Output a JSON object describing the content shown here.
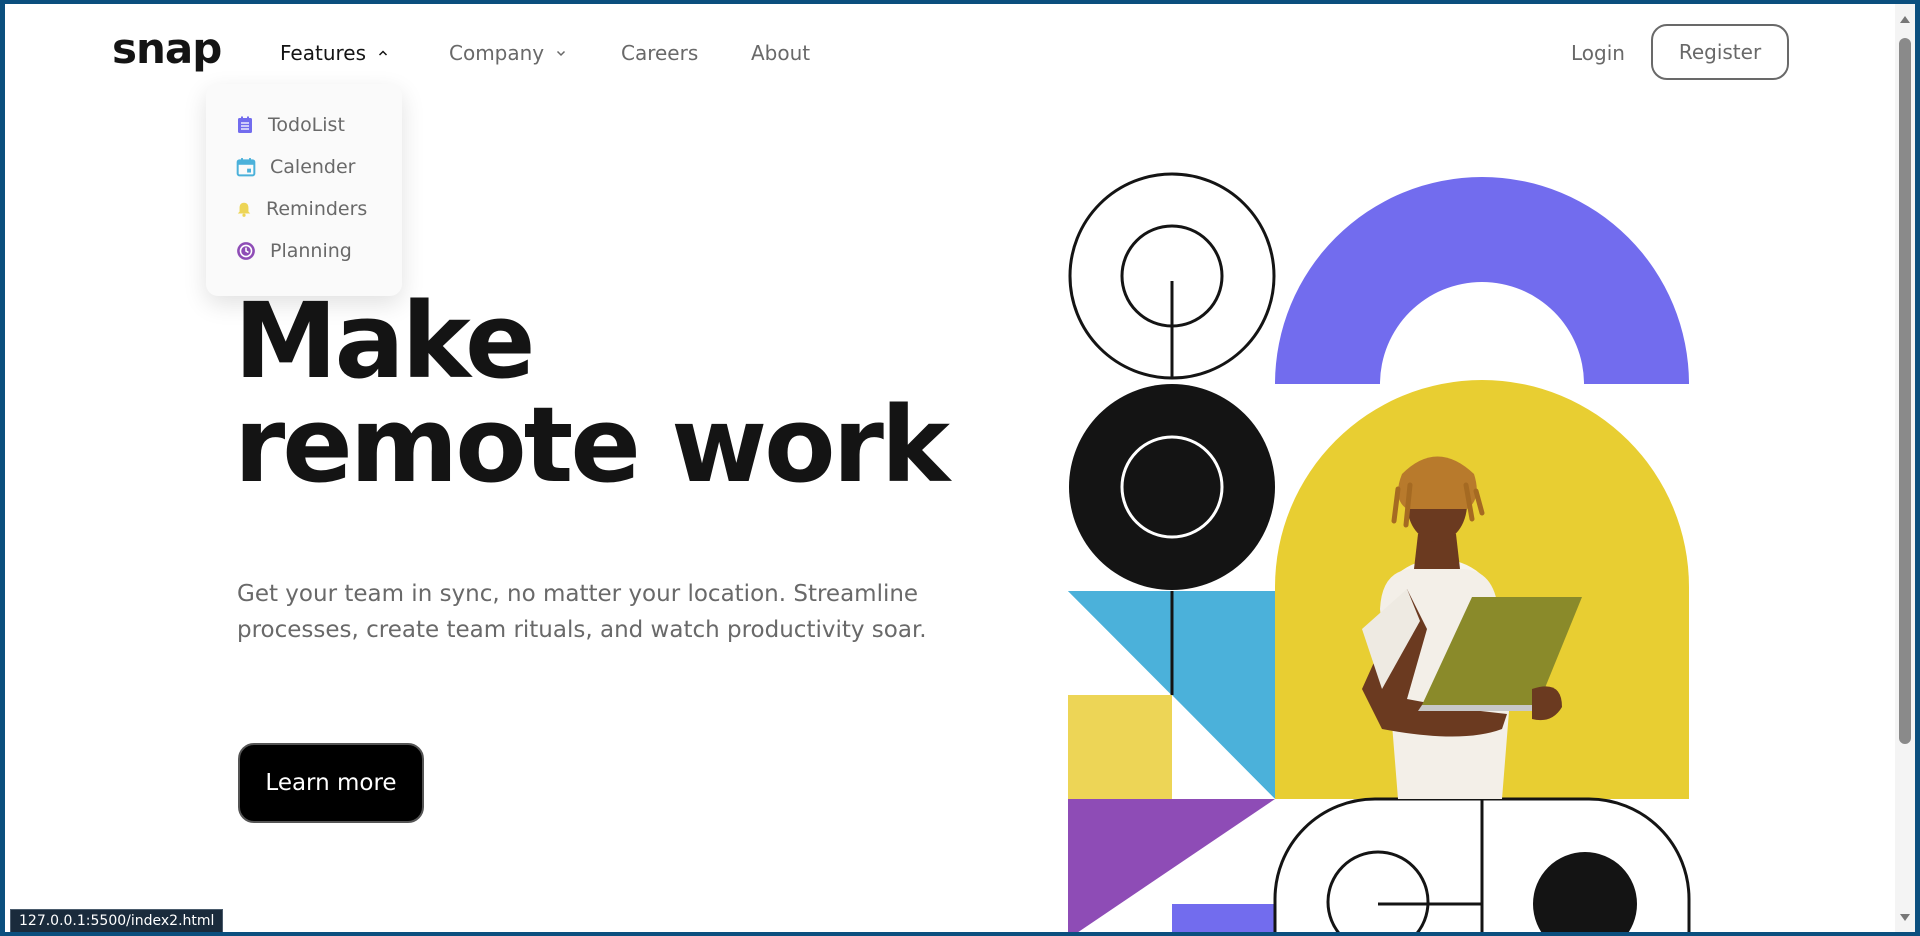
{
  "nav": {
    "logo": "snap",
    "items": [
      {
        "label": "Features"
      },
      {
        "label": "Company"
      },
      {
        "label": "Careers"
      },
      {
        "label": "About"
      }
    ],
    "login": "Login",
    "register": "Register"
  },
  "features_dropdown": {
    "items": [
      {
        "label": "TodoList",
        "icon": "todo-icon",
        "color": "#726CEE"
      },
      {
        "label": "Calender",
        "icon": "calendar-icon",
        "color": "#4BB1DA"
      },
      {
        "label": "Reminders",
        "icon": "bell-icon",
        "color": "#EDD556"
      },
      {
        "label": "Planning",
        "icon": "clock-icon",
        "color": "#8E4CB6"
      }
    ]
  },
  "hero": {
    "title_line1": "Make",
    "title_line2": "remote work",
    "text": "Get your team in sync, no matter your location. Streamline processes, create team rituals, and watch productivity soar.",
    "cta": "Learn more"
  },
  "status_bar": {
    "url": "127.0.0.1:5500/index2.html"
  },
  "colors": {
    "purple": "#726CEE",
    "blue": "#4BB1DA",
    "yellow": "#EDD556",
    "violet": "#8E4CB6",
    "dark": "#141414",
    "gray": "#696969"
  }
}
